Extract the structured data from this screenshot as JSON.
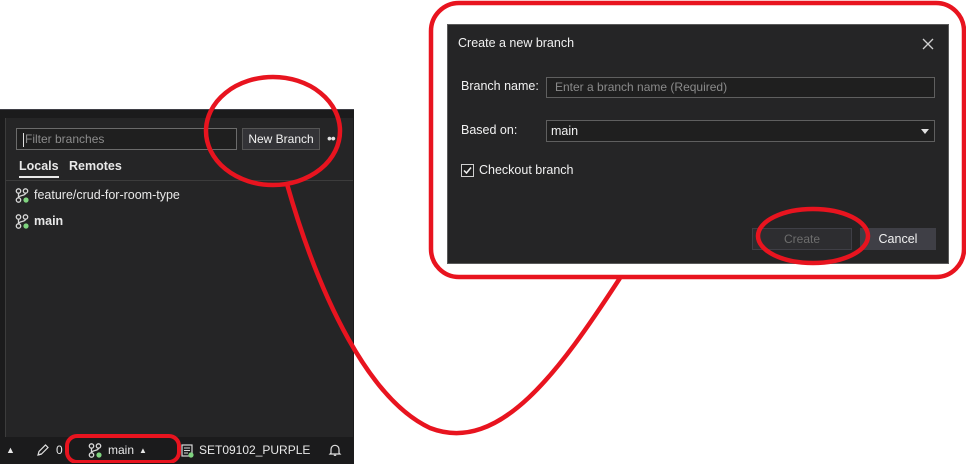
{
  "branches_panel": {
    "filter_placeholder": "Filter branches",
    "new_branch_label": "New Branch",
    "more_label": "••",
    "tabs": [
      {
        "label": "Locals",
        "active": true
      },
      {
        "label": "Remotes",
        "active": false
      }
    ],
    "branches": [
      {
        "name": "feature/crud-for-room-type",
        "current": false
      },
      {
        "name": "main",
        "current": true
      }
    ]
  },
  "status_bar": {
    "arrow": "▲",
    "changes_count": "0",
    "branch": "main",
    "branch_arrow": "▲",
    "repo": "SET09102_PURPLE"
  },
  "dialog": {
    "title": "Create a new branch",
    "branch_name_label": "Branch name:",
    "branch_name_placeholder": "Enter a branch name (Required)",
    "based_on_label": "Based on:",
    "based_on_value": "main",
    "checkout_label": "Checkout branch",
    "checkout_checked": true,
    "create_label": "Create",
    "cancel_label": "Cancel"
  },
  "colors": {
    "annotation": "#e8141f",
    "panel_bg": "#252526",
    "git_icon_green": "#7fd47f"
  }
}
